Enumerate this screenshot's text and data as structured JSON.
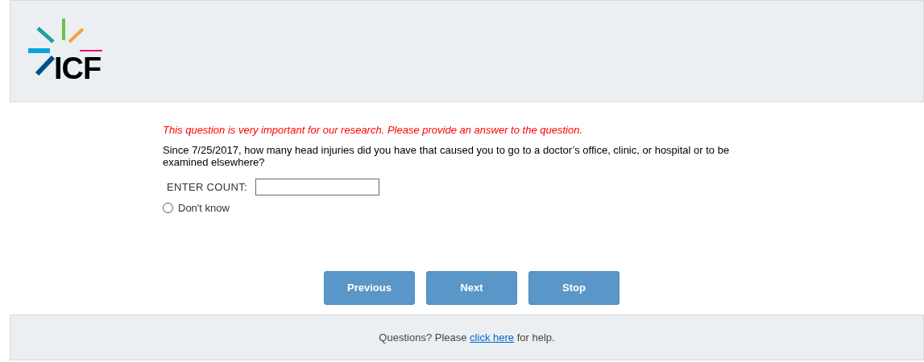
{
  "header": {
    "logo_text": "ICF"
  },
  "warning": "This question is very important for our research. Please provide an answer to the question.",
  "question": "Since 7/25/2017, how many head injuries did you have that caused you to go to a doctor’s office, clinic, or hospital or to be examined elsewhere?",
  "count_field": {
    "label": "ENTER COUNT:"
  },
  "options": [
    {
      "label": "Don't know",
      "selected": false
    }
  ],
  "buttons": [
    "Previous",
    "Next",
    "Stop"
  ],
  "footer": {
    "before": "Questions? Please",
    "link": "click here",
    "after": "for help."
  }
}
